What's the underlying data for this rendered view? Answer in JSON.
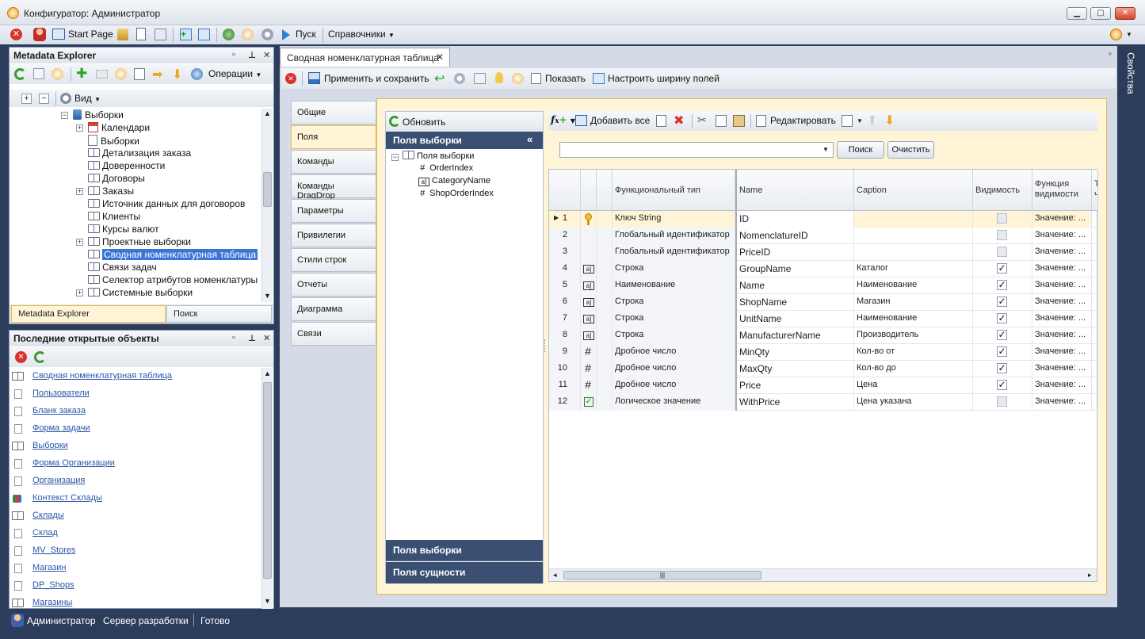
{
  "window": {
    "title": "Конфигуратор: Администратор"
  },
  "toolbar": {
    "start_page": "Start Page",
    "run": "Пуск",
    "references": "Справочники"
  },
  "metadata_explorer": {
    "title": "Metadata Explorer",
    "operations": "Операции",
    "view": "Вид",
    "tree": [
      {
        "label": "Выборки"
      },
      {
        "label": "Календари"
      },
      {
        "label": "Выборки"
      },
      {
        "label": "Детализация заказа"
      },
      {
        "label": "Доверенности"
      },
      {
        "label": "Договоры"
      },
      {
        "label": "Заказы"
      },
      {
        "label": "Источник данных для договоров"
      },
      {
        "label": "Клиенты"
      },
      {
        "label": "Курсы валют"
      },
      {
        "label": "Проектные выборки"
      },
      {
        "label": "Сводная номенклатурная таблица"
      },
      {
        "label": "Связи задач"
      },
      {
        "label": "Селектор атрибутов номенклатуры"
      },
      {
        "label": "Системные выборки"
      }
    ],
    "tab_explorer": "Metadata Explorer",
    "tab_search": "Поиск"
  },
  "recent": {
    "title": "Последние открытые объекты",
    "items": [
      {
        "label": "Сводная номенклатурная таблица"
      },
      {
        "label": "Пользователи"
      },
      {
        "label": "Бланк заказа"
      },
      {
        "label": "Форма задачи"
      },
      {
        "label": "Выборки"
      },
      {
        "label": "Форма Организации"
      },
      {
        "label": "Организация"
      },
      {
        "label": "Контекст Склады"
      },
      {
        "label": "Склады"
      },
      {
        "label": "Склад"
      },
      {
        "label": "MV_Stores"
      },
      {
        "label": "Магазин"
      },
      {
        "label": "DP_Shops"
      },
      {
        "label": "Магазины"
      }
    ]
  },
  "statusbar": {
    "user": "Администратор",
    "server": "Сервер разработки",
    "status": "Готово"
  },
  "document": {
    "tab_title": "Сводная номенклатурная таблица",
    "toolbar": {
      "apply_save": "Применить и сохранить",
      "show": "Показать",
      "set_width": "Настроить ширину полей"
    },
    "side_tabs": [
      "Общие",
      "Поля",
      "Команды",
      "Команды DragDrop",
      "Параметры",
      "Привилегии",
      "Стили строк",
      "Отчеты",
      "Диаграмма",
      "Связи"
    ],
    "refresh": "Обновить",
    "fields_header": "Поля выборки",
    "fields_tree": {
      "root": "Поля выборки",
      "children": [
        "OrderIndex",
        "CategoryName",
        "ShopOrderIndex"
      ]
    },
    "bottom_sections": [
      "Поля выборки",
      "Поля сущности"
    ],
    "grid_toolbar": {
      "add_all": "Добавить все",
      "edit": "Редактировать"
    },
    "search": {
      "value": "",
      "search_btn": "Поиск",
      "clear_btn": "Очистить"
    },
    "columns": [
      "Функциональный тип",
      "Name",
      "Caption",
      "Видимость",
      "Функция видимости",
      "Т ч"
    ],
    "rows": [
      {
        "n": "1",
        "icon": "key",
        "type": "Ключ String",
        "name": "ID",
        "caption": "",
        "visible": false,
        "func": "Значение: ..."
      },
      {
        "n": "2",
        "icon": "",
        "type": "Глобальный идентификатор",
        "name": "NomenclatureID",
        "caption": "",
        "visible": false,
        "func": "Значение: ..."
      },
      {
        "n": "3",
        "icon": "",
        "type": "Глобальный идентификатор",
        "name": "PriceID",
        "caption": "",
        "visible": false,
        "func": "Значение: ..."
      },
      {
        "n": "4",
        "icon": "string",
        "type": "Строка",
        "name": "GroupName",
        "caption": "Каталог",
        "visible": true,
        "func": "Значение: ..."
      },
      {
        "n": "5",
        "icon": "string",
        "type": "Наименование",
        "name": "Name",
        "caption": "Наименование",
        "visible": true,
        "func": "Значение: ..."
      },
      {
        "n": "6",
        "icon": "string",
        "type": "Строка",
        "name": "ShopName",
        "caption": "Магазин",
        "visible": true,
        "func": "Значение: ..."
      },
      {
        "n": "7",
        "icon": "string",
        "type": "Строка",
        "name": "UnitName",
        "caption": "Наименование",
        "visible": true,
        "func": "Значение: ..."
      },
      {
        "n": "8",
        "icon": "string",
        "type": "Строка",
        "name": "ManufacturerName",
        "caption": "Производитель",
        "visible": true,
        "func": "Значение: ..."
      },
      {
        "n": "9",
        "icon": "hash",
        "type": "Дробное число",
        "name": "MinQty",
        "caption": "Кол-во от",
        "visible": true,
        "func": "Значение: ..."
      },
      {
        "n": "10",
        "icon": "hash",
        "type": "Дробное число",
        "name": "MaxQty",
        "caption": "Кол-во до",
        "visible": true,
        "func": "Значение: ..."
      },
      {
        "n": "11",
        "icon": "hash",
        "type": "Дробное число",
        "name": "Price",
        "caption": "Цена",
        "visible": true,
        "func": "Значение: ..."
      },
      {
        "n": "12",
        "icon": "bool",
        "type": "Логическое значение",
        "name": "WithPrice",
        "caption": "Цена указана",
        "visible": false,
        "func": "Значение: ..."
      }
    ]
  },
  "right_panel": {
    "label": "Свойства"
  },
  "colors": {
    "accent_orange": "#f1c35a",
    "selection": "#3875d7",
    "frame": "#2b3d5a"
  }
}
